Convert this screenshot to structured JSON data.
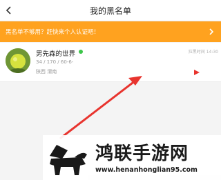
{
  "header": {
    "title": "我的黑名单",
    "back_icon": "chevron-left-icon"
  },
  "banner": {
    "text": "黑名单不够用？赶快来个人认证吧！",
    "background": "#ffa21f",
    "chevron_icon": "chevron-right-icon"
  },
  "blocked_user": {
    "name": "男先森的世界",
    "online_status_color": "#3cc54a",
    "stats": "34 / 170 / 60-6-",
    "location": "陕西 渭南",
    "blocked_time": "拉黑时间 14:30",
    "action_icon": "play-triangle-icon",
    "action_color": "#e8342e"
  },
  "annotation": {
    "arrow_color": "#e8342e"
  },
  "watermark": {
    "title": "鸿联手游网",
    "url": "www.henanhonglian95.com",
    "logo": "bison-logo"
  }
}
